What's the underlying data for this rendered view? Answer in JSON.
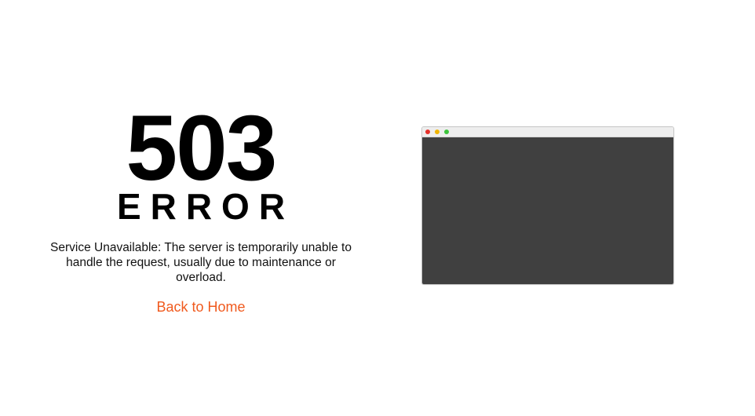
{
  "error": {
    "code": "503",
    "word": "ERROR",
    "message": "Service Unavailable: The server is temporarily unable to handle the request, usually due to maintenance or overload.",
    "link_label": "Back to Home"
  },
  "colors": {
    "link": "#f05a1e",
    "close_dot": "#e4302a",
    "minimize_dot": "#f0b400",
    "maximize_dot": "#3cc43c",
    "screen": "#404040"
  }
}
